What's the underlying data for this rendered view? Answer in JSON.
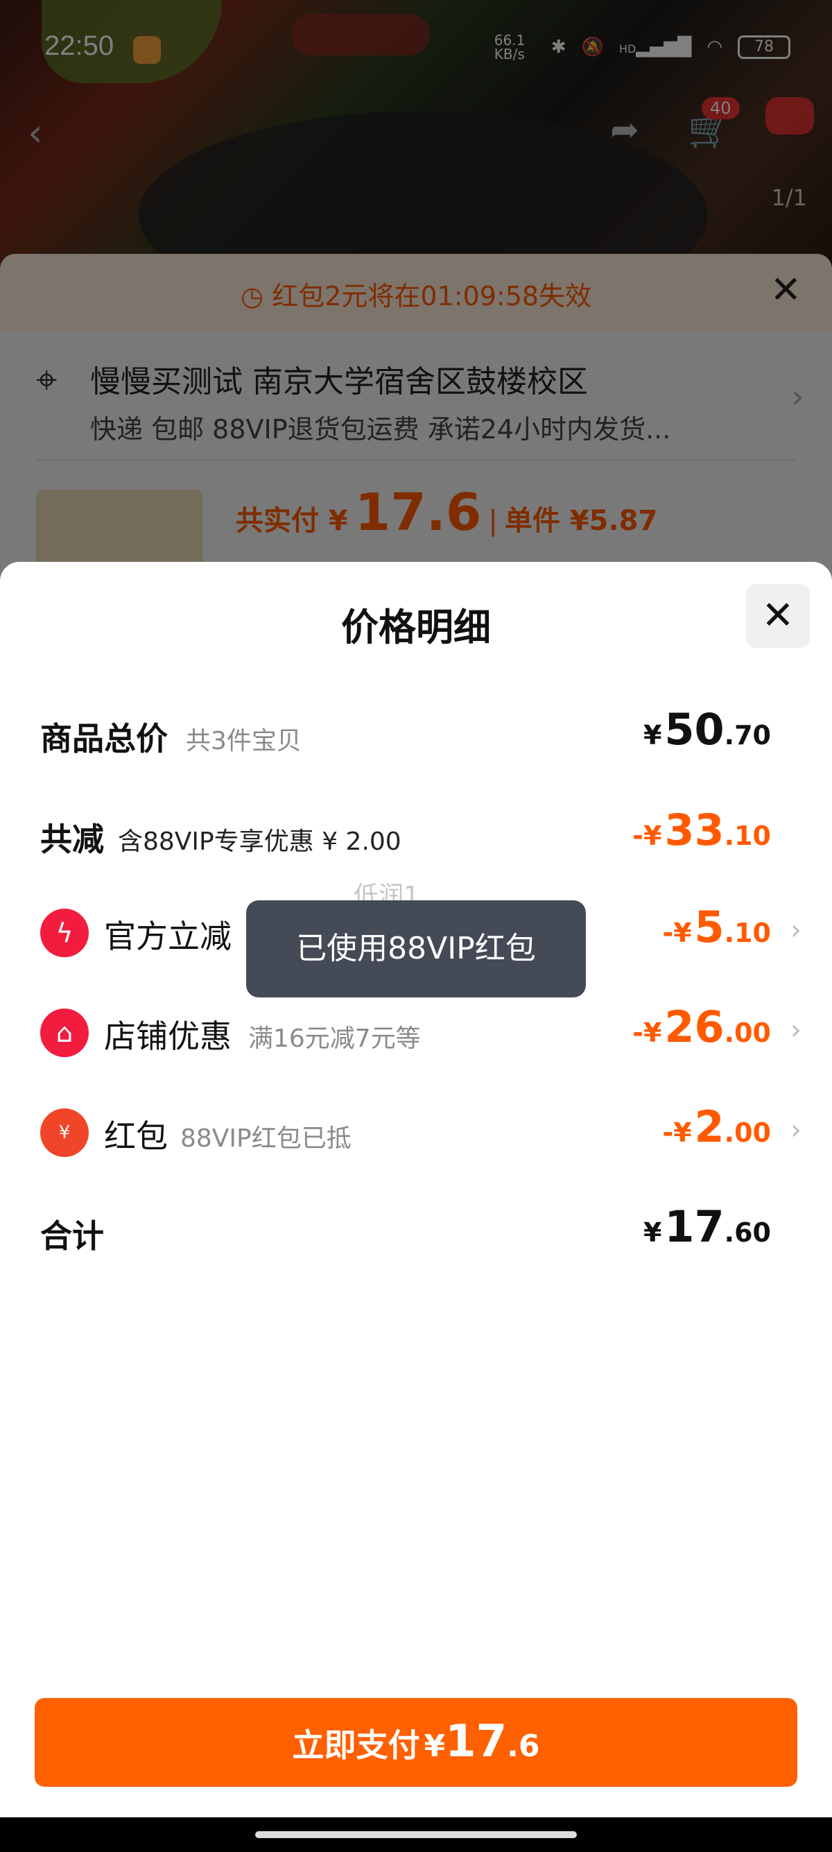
{
  "status_bar": {
    "time": "22:50",
    "net_speed": "66.1 KB/s",
    "signal": "HD",
    "battery": "78"
  },
  "top_nav": {
    "cart_badge": "40",
    "page_indicator": "1/1"
  },
  "order_sheet": {
    "expire_notice": "红包2元将在01:09:58失效",
    "address_line1": "慢慢买测试 南京大学宿舍区鼓楼校区",
    "address_line2": "快递 包邮 88VIP退货包运费 承诺24小时内发货...",
    "total_label": "共实付 ¥",
    "total_amount": "17.6",
    "unit_label": "单件 ¥5.87"
  },
  "price_sheet": {
    "title": "价格明细",
    "rows": [
      {
        "label": "商品总价",
        "sub": "共3件宝贝",
        "currency": "¥",
        "int": "50",
        "dec": ".70"
      },
      {
        "label": "共减",
        "sub": "含88VIP专享优惠 ¥ 2.00",
        "currency": "-¥",
        "int": "33",
        "dec": ".10"
      },
      {
        "label": "官方立减",
        "sub": "",
        "currency": "-¥",
        "int": "5",
        "dec": ".10"
      },
      {
        "label": "店铺优惠",
        "sub": "满16元减7元等",
        "currency": "-¥",
        "int": "26",
        "dec": ".00"
      },
      {
        "label": "红包",
        "sub": "88VIP红包已抵",
        "currency": "-¥",
        "int": "2",
        "dec": ".00"
      },
      {
        "label": "合计",
        "sub": "",
        "currency": "¥",
        "int": "17",
        "dec": ".60"
      }
    ],
    "toast": "已使用88VIP红包",
    "toast_ghost": "低润1"
  },
  "pay_button": {
    "label": "立即支付",
    "currency": "¥",
    "int": "17",
    "dec": ".6"
  },
  "colors": {
    "accent": "#ff6000",
    "discount": "#ff5a00",
    "icon_red": "#f21c3f"
  }
}
